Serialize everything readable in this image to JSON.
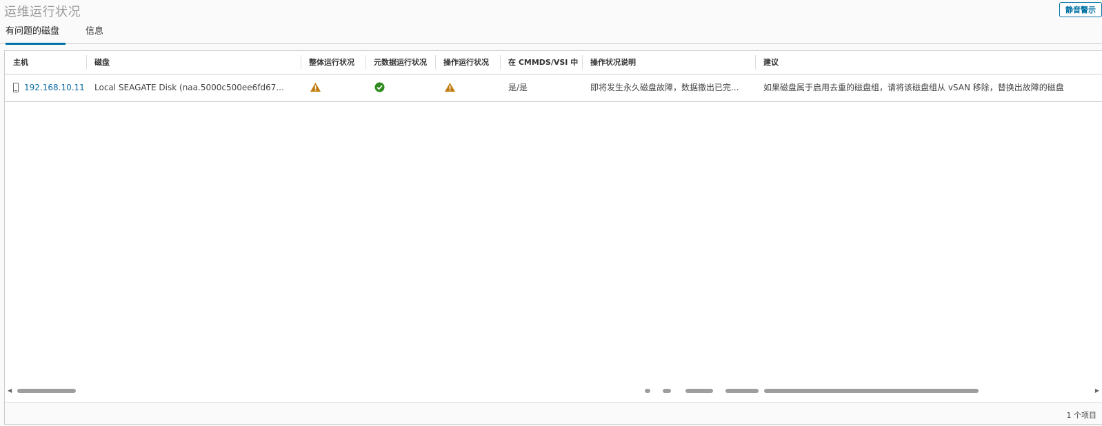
{
  "page": {
    "title": "运维运行状况"
  },
  "toolbar": {
    "mute_label": "静音警示"
  },
  "tabs": [
    {
      "label": "有问题的磁盘",
      "active": true
    },
    {
      "label": "信息",
      "active": false
    }
  ],
  "table": {
    "columns": [
      "主机",
      "磁盘",
      "整体运行状况",
      "元数据运行状况",
      "操作运行状况",
      "在 CMMDS/VSI 中",
      "操作状况说明",
      "建议"
    ],
    "rows": [
      {
        "host": "192.168.10.11",
        "disk": "Local SEAGATE Disk (naa.5000c500ee6fd67...",
        "overall_health": "warning-icon",
        "metadata_health": "ok-icon",
        "operational_health": "warning-icon",
        "in_cmmds_vsi": "是/是",
        "operational_description": "即将发生永久磁盘故障，数据撤出已完...",
        "recommendation": "如果磁盘属于启用去重的磁盘组，请将该磁盘组从 vSAN 移除，替换出故障的磁盘"
      }
    ]
  },
  "footer": {
    "item_count": "1 个项目"
  },
  "colors": {
    "accent": "#0072a3",
    "warning": "#c27c0e",
    "ok": "#2e8b1e",
    "link": "#0b6aa2"
  }
}
